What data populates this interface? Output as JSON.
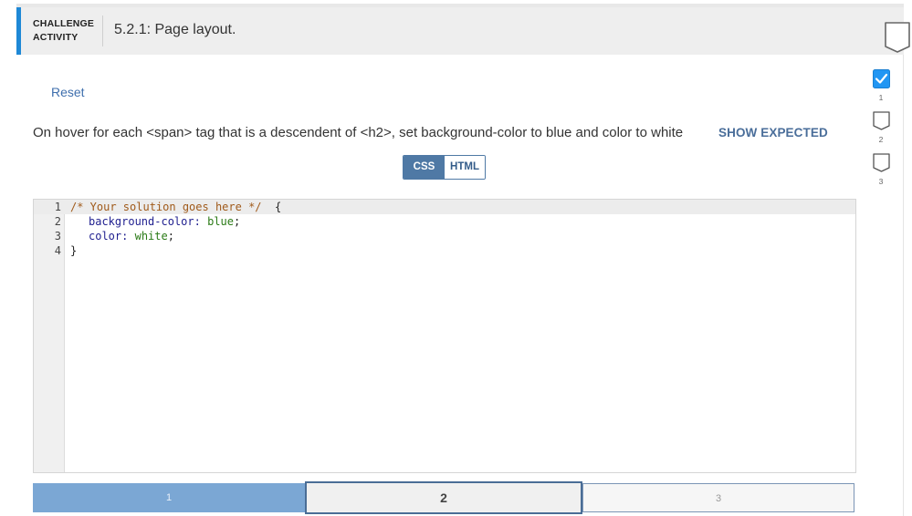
{
  "header": {
    "activity_line1": "CHALLENGE",
    "activity_line2": "ACTIVITY",
    "title": "5.2.1: Page layout."
  },
  "controls": {
    "reset_label": "Reset",
    "instructions": "On hover for each <span> tag that is a descendent of <h2>, set background-color to blue and color to white",
    "show_expected_label": "SHOW EXPECTED"
  },
  "tabs": [
    {
      "label": "CSS",
      "active": true
    },
    {
      "label": "HTML",
      "active": false
    }
  ],
  "editor": {
    "lines": [
      {
        "num": "1",
        "comment": "/* Your solution goes here */",
        "rest": "  {"
      },
      {
        "num": "2",
        "prop": "background-color:",
        "value": "blue",
        "end": ";"
      },
      {
        "num": "3",
        "prop": "color:",
        "value": "white",
        "end": ";"
      },
      {
        "num": "4",
        "text": "}"
      }
    ]
  },
  "progress": {
    "segments": [
      {
        "label": "1",
        "state": "completed"
      },
      {
        "label": "2",
        "state": "current"
      },
      {
        "label": "3",
        "state": "upcoming"
      }
    ]
  },
  "side_checks": [
    {
      "label": "1",
      "checked": true
    },
    {
      "label": "2",
      "checked": false
    },
    {
      "label": "3",
      "checked": false
    }
  ],
  "colors": {
    "accent": "#1e88d6",
    "tab_active": "#4f79a5",
    "progress_done": "#7ba7d4",
    "check_fill": "#2196f3"
  },
  "icons": [
    "completion-shield-icon",
    "checked-box-icon",
    "unchecked-box-icon"
  ]
}
